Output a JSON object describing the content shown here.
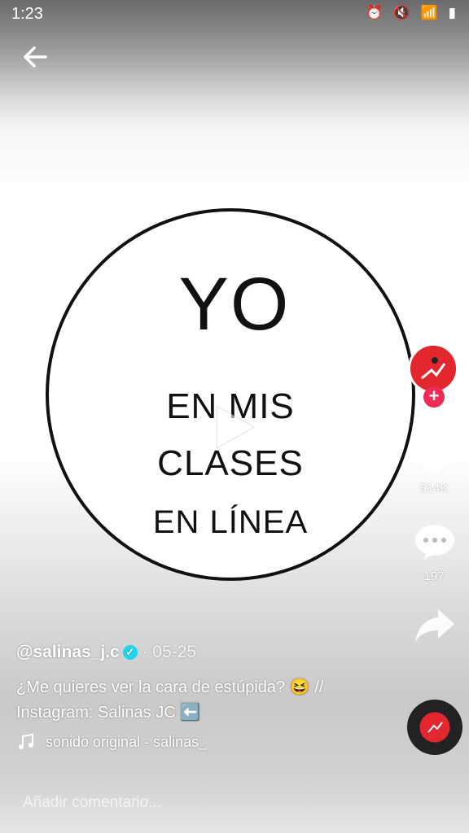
{
  "status_bar": {
    "time": "1:23",
    "icons": "⏰ 🔇 📶 ▮"
  },
  "video": {
    "title_big": "YO",
    "line1": "EN MIS",
    "line2": "CLASES",
    "line3": "EN LÍNEA"
  },
  "rail": {
    "likes": "514K",
    "comments": "197"
  },
  "caption": {
    "username": "@salinas_j.c",
    "date": "· 05-25",
    "description": "¿Me quieres ver la cara de estúpida? 😆 // Instagram: Salinas JC ⬅️",
    "sound": "sonido original - salinas_"
  },
  "comment": {
    "placeholder": "Añadir comentario..."
  },
  "colors": {
    "accent": "#ef2b55",
    "verified": "#20d5ec"
  }
}
